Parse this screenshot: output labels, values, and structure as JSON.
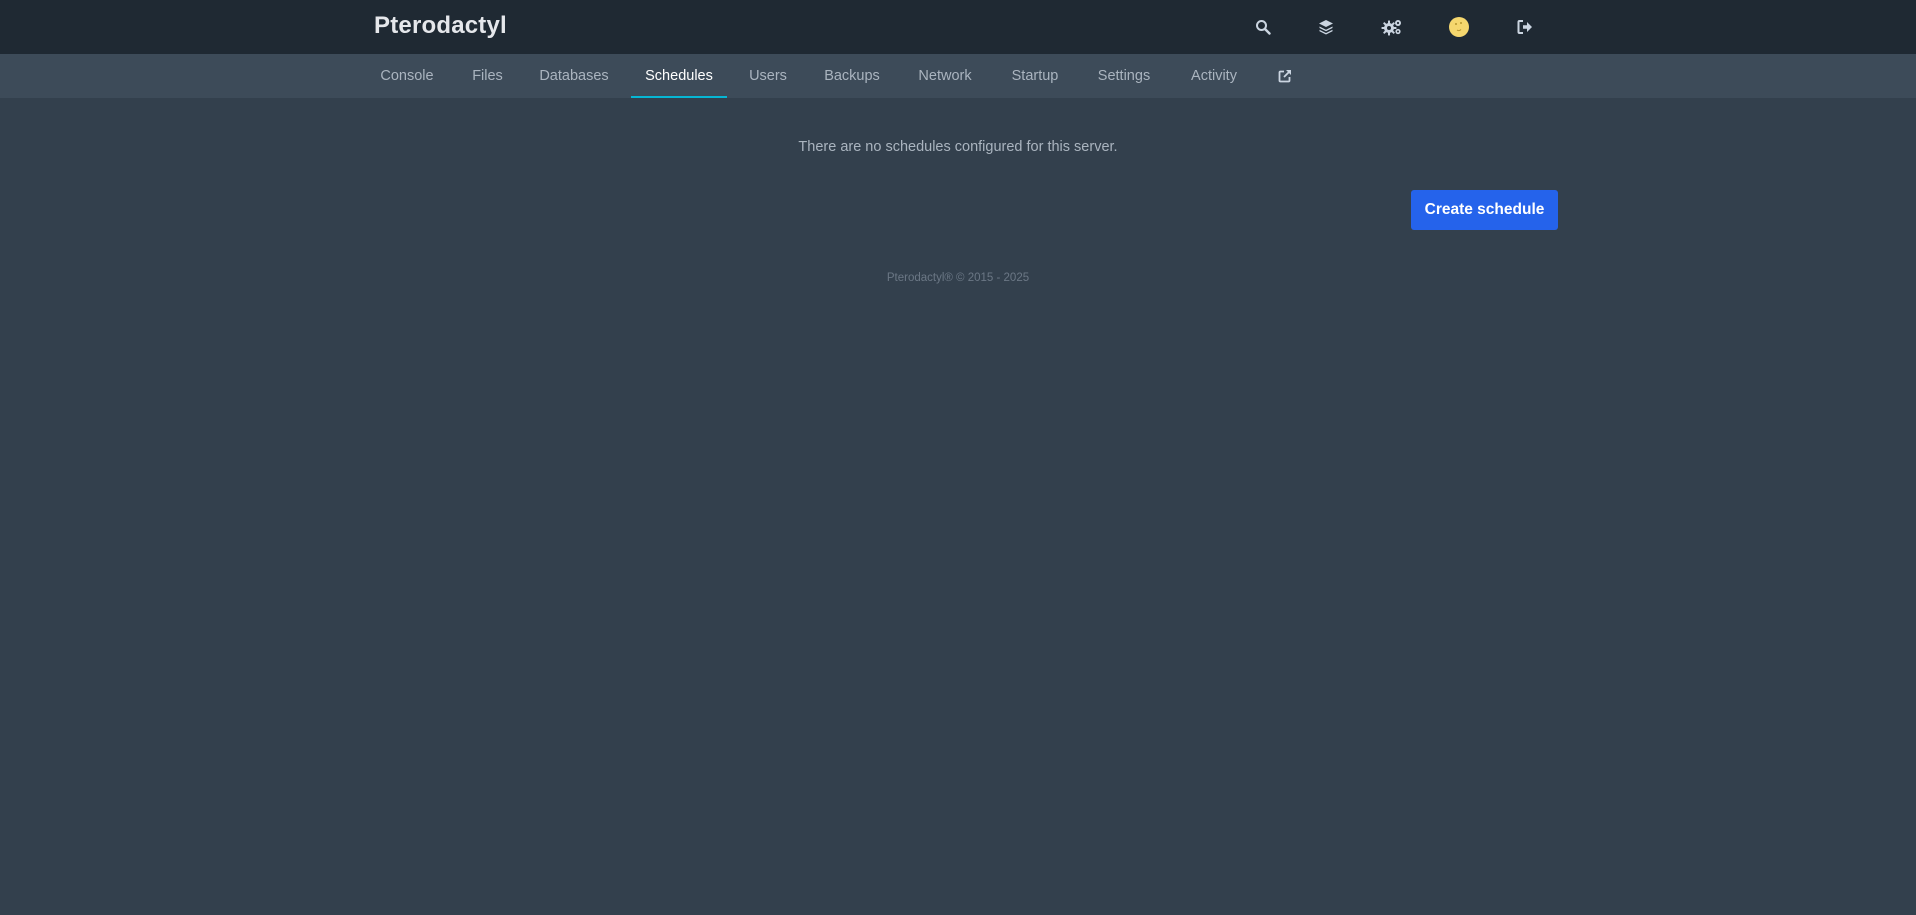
{
  "header": {
    "brand": "Pterodactyl",
    "icons": [
      "search-icon",
      "layers-icon",
      "cogs-icon",
      "avatar",
      "sign-out-icon"
    ]
  },
  "nav": {
    "tabs": [
      {
        "label": "Console",
        "active": false
      },
      {
        "label": "Files",
        "active": false
      },
      {
        "label": "Databases",
        "active": false
      },
      {
        "label": "Schedules",
        "active": true
      },
      {
        "label": "Users",
        "active": false
      },
      {
        "label": "Backups",
        "active": false
      },
      {
        "label": "Network",
        "active": false
      },
      {
        "label": "Startup",
        "active": false
      },
      {
        "label": "Settings",
        "active": false
      },
      {
        "label": "Activity",
        "active": false
      }
    ],
    "external_icon": "external-link-icon"
  },
  "main": {
    "empty_message": "There are no schedules configured for this server.",
    "create_button": "Create schedule"
  },
  "footer": {
    "text": "Pterodactyl® © 2015 - 2025"
  },
  "colors": {
    "accent": "#2563eb",
    "active_tab_underline": "#06b6d4",
    "avatar": "#f5d76e"
  }
}
